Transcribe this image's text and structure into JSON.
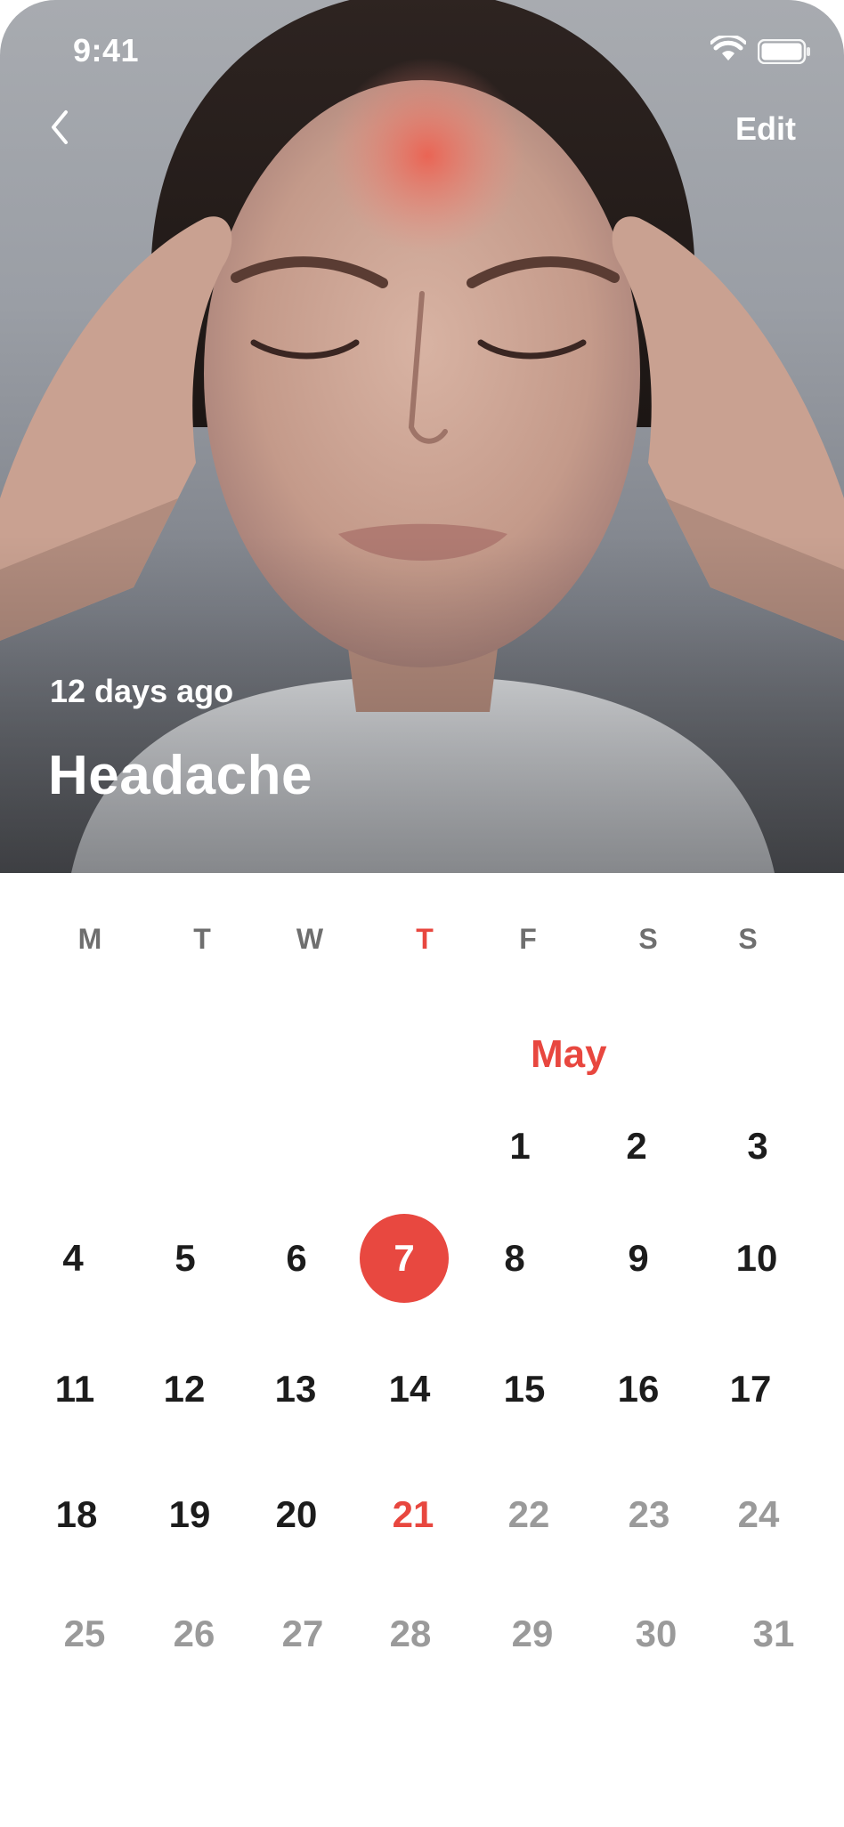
{
  "status_bar": {
    "time": "9:41",
    "icons": [
      "wifi-icon",
      "battery-icon"
    ]
  },
  "nav": {
    "back_icon": "chevron-left-icon",
    "edit_label": "Edit"
  },
  "hero": {
    "ago": "12 days ago",
    "title": "Headache"
  },
  "calendar": {
    "month": "May",
    "weekdays": [
      "M",
      "T",
      "W",
      "T",
      "F",
      "S",
      "S"
    ],
    "today_weekday_index": 3,
    "days": [
      {
        "label": "1"
      },
      {
        "label": "2"
      },
      {
        "label": "3"
      },
      {
        "label": "4"
      },
      {
        "label": "5"
      },
      {
        "label": "6"
      },
      {
        "label": "7",
        "state": "selected"
      },
      {
        "label": "8"
      },
      {
        "label": "9"
      },
      {
        "label": "10"
      },
      {
        "label": "11"
      },
      {
        "label": "12"
      },
      {
        "label": "13"
      },
      {
        "label": "14"
      },
      {
        "label": "15"
      },
      {
        "label": "16"
      },
      {
        "label": "17"
      },
      {
        "label": "18"
      },
      {
        "label": "19"
      },
      {
        "label": "20"
      },
      {
        "label": "21",
        "state": "today"
      },
      {
        "label": "22",
        "state": "future"
      },
      {
        "label": "23",
        "state": "future"
      },
      {
        "label": "24",
        "state": "future"
      },
      {
        "label": "25",
        "state": "future"
      },
      {
        "label": "26",
        "state": "future"
      },
      {
        "label": "27",
        "state": "future"
      },
      {
        "label": "28",
        "state": "future"
      },
      {
        "label": "29",
        "state": "future"
      },
      {
        "label": "30",
        "state": "future"
      },
      {
        "label": "31",
        "state": "future"
      }
    ]
  },
  "colors": {
    "accent": "#e8473f",
    "text": "#1c1c1c",
    "muted": "#9a9a9a",
    "weekday": "#6f6f6f"
  }
}
